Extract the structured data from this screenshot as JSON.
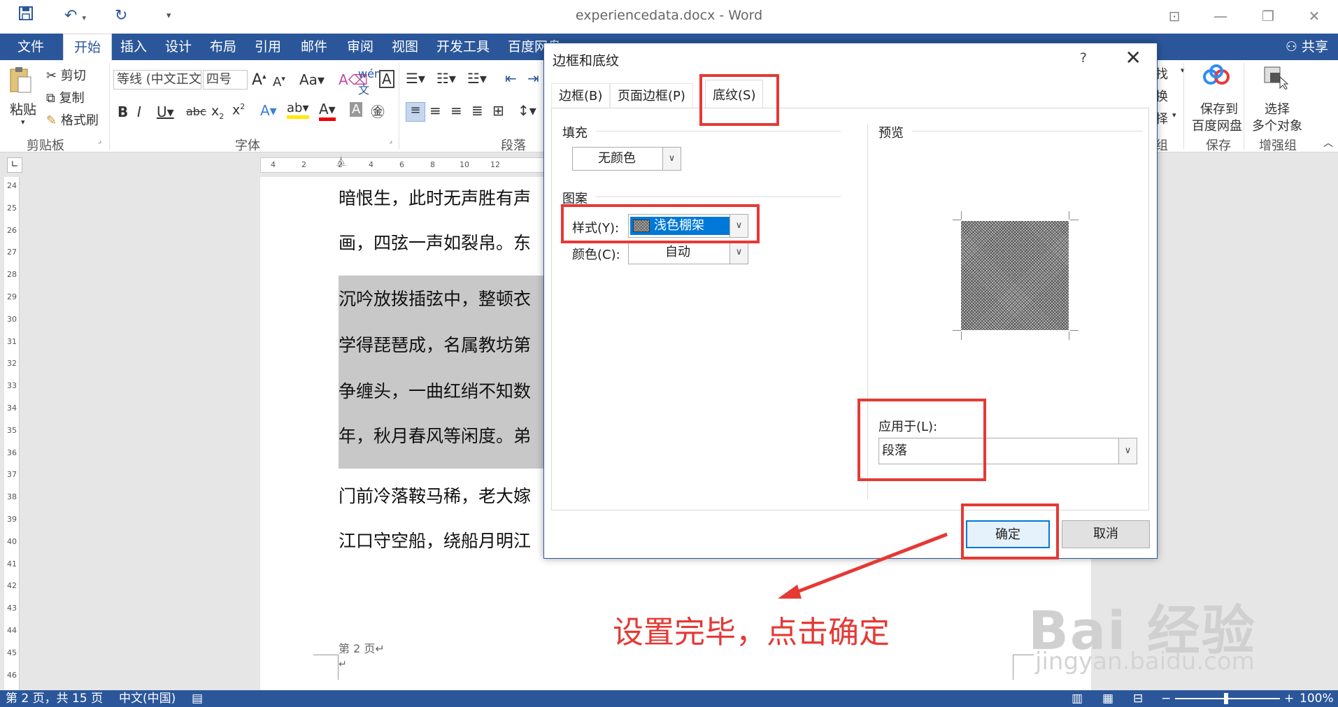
{
  "title_bar": {
    "doc_title": "experiencedata.docx - Word",
    "undo_icon": "undo-icon",
    "redo_icon": "redo-icon",
    "save_icon": "save-icon"
  },
  "ribbon_tabs": [
    "文件",
    "开始",
    "插入",
    "设计",
    "布局",
    "引用",
    "邮件",
    "审阅",
    "视图",
    "开发工具",
    "百度网盘"
  ],
  "share_label": "共享",
  "clipboard": {
    "paste": "粘贴",
    "cut": "剪切",
    "copy": "复制",
    "format_painter": "格式刷",
    "group": "剪贴板"
  },
  "font": {
    "family": "等线 (中文正文",
    "size": "四号",
    "group": "字体"
  },
  "paragraph": {
    "group": "段落"
  },
  "right_groups": {
    "find_1": "找",
    "find_2": "换",
    "find_3": "择",
    "group_edit": "组",
    "save_to": "保存到",
    "baidu_disk": "百度网盘",
    "save_group": "保存",
    "select": "选择",
    "multi_obj": "多个对象",
    "enhance_group": "增强组"
  },
  "ruler_numbers": [
    "4",
    "2",
    "2",
    "4",
    "6",
    "8",
    "10",
    "12"
  ],
  "vruler_numbers": [
    "24",
    "25",
    "26",
    "27",
    "28",
    "29",
    "30",
    "31",
    "32",
    "33",
    "34",
    "35",
    "36",
    "37",
    "38",
    "39",
    "40",
    "41",
    "42",
    "43",
    "44",
    "45",
    "46"
  ],
  "document": {
    "lines": [
      "暗恨生，此时无声胜有声",
      "画，四弦一声如裂帛。东",
      "沉吟放拨插弦中，整顿衣",
      "学得琵琶成，名属教坊第",
      "争缠头，一曲红绡不知数",
      "年，秋月春风等闲度。弟",
      "门前冷落鞍马稀，老大嫁",
      "江口守空船，绕船月明江"
    ],
    "page_label": "第 2 页",
    "return_mark": "↵"
  },
  "dialog": {
    "title": "边框和底纹",
    "help": "?",
    "tabs": [
      "边框(B)",
      "页面边框(P)",
      "底纹(S)"
    ],
    "fill_label": "填充",
    "fill_value": "无颜色",
    "pattern_label": "图案",
    "style_label": "样式(Y):",
    "style_value": "浅色棚架",
    "color_label": "颜色(C):",
    "color_value": "自动",
    "preview_label": "预览",
    "apply_label": "应用于(L):",
    "apply_value": "段落",
    "ok": "确定",
    "cancel": "取消"
  },
  "annotation": "设置完毕，点击确定",
  "status": {
    "page": "第 2 页，共 15 页",
    "lang": "中文(中国)",
    "zoom": "100%"
  },
  "watermark": {
    "brand": "Bai 经验",
    "url": "jingyan.baidu.com"
  },
  "colors": {
    "accent": "#2b579a",
    "highlight": "#e53935"
  }
}
